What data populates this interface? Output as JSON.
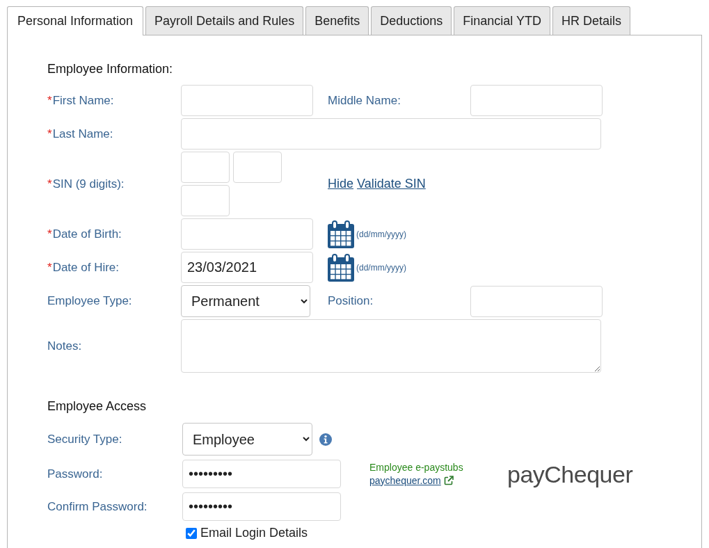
{
  "tabs": [
    {
      "label": "Personal Information",
      "selected": true
    },
    {
      "label": "Payroll Details and Rules",
      "selected": false
    },
    {
      "label": "Benefits",
      "selected": false
    },
    {
      "label": "Deductions",
      "selected": false
    },
    {
      "label": "Financial YTD",
      "selected": false
    },
    {
      "label": "HR Details",
      "selected": false
    }
  ],
  "employee_information": {
    "heading": "Employee Information:",
    "rows": [
      {
        "fields": [
          {
            "kind": "text",
            "mark": "*",
            "label": "First Name:"
          },
          {
            "kind": "text",
            "label": "Middle Name:"
          }
        ]
      },
      {
        "fields": [
          {
            "kind": "wide_text",
            "mark": "*",
            "label": "Last Name:"
          }
        ]
      },
      {
        "fields": [
          {
            "kind": "sin",
            "mark": "*",
            "label": "SIN (9 digits):",
            "links": [
              "Hide",
              "Validate SIN"
            ]
          }
        ]
      },
      {
        "fields": [
          {
            "kind": "date",
            "mark": "*",
            "label": "Date of Birth:",
            "hint": "(dd/mm/yyyy)"
          }
        ]
      },
      {
        "fields": [
          {
            "kind": "date",
            "mark": "*",
            "label": "Date of Hire:",
            "value": "23/03/2021",
            "hint": "(dd/mm/yyyy)"
          }
        ]
      },
      {
        "fields": [
          {
            "kind": "select",
            "label": "Employee Type:",
            "value": "Permanent"
          },
          {
            "kind": "text",
            "label": "Position:"
          }
        ]
      },
      {
        "fields": [
          {
            "kind": "textarea",
            "label": "Notes:"
          }
        ]
      }
    ]
  },
  "employee_access": {
    "heading": "Employee Access",
    "security_type": {
      "label": "Security Type:",
      "value": "Employee"
    },
    "password": {
      "label": "Password:",
      "value": "•••••••••"
    },
    "confirm_password": {
      "label": "Confirm Password:",
      "value": "•••••••••"
    },
    "email_login_details": {
      "label": "Email Login Details",
      "checked": true
    },
    "e_paystubs": {
      "caption": "Employee e-paystubs",
      "link": "paychequer.com"
    },
    "logo": {
      "text": "payChequer"
    }
  }
}
